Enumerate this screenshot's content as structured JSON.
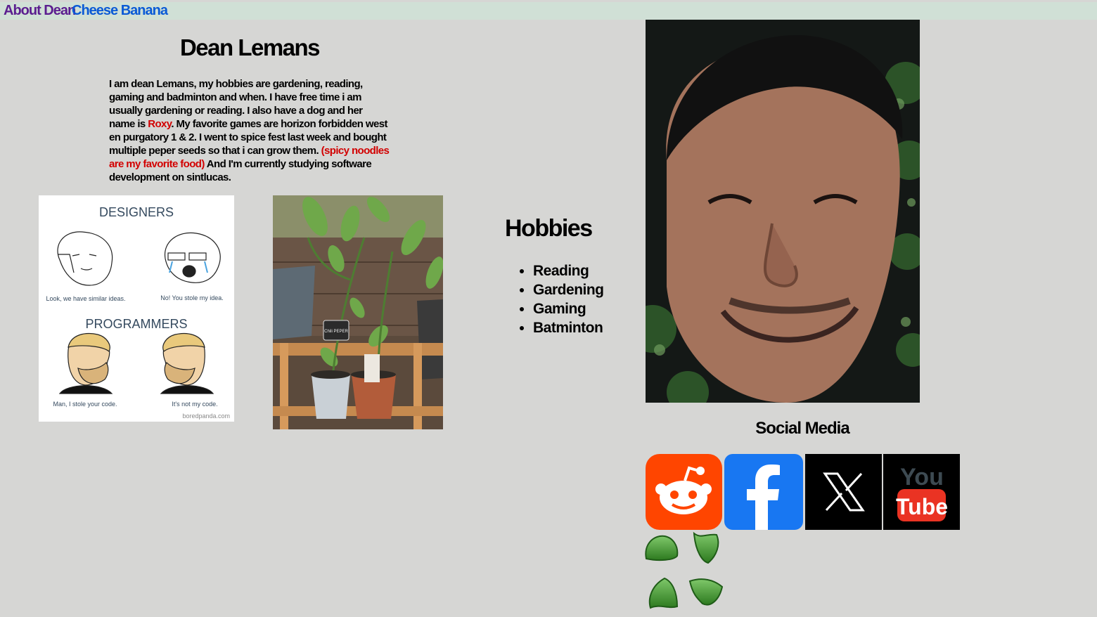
{
  "nav": {
    "about_label": "About Dean",
    "cheese_label": "Cheese Banana"
  },
  "profile": {
    "name": "Dean Lemans",
    "bio": {
      "part1": "I am dean Lemans, my hobbies are gardening, reading, gaming and badminton and when. I have free time i am usually gardening or reading. I also have a dog and her name is ",
      "dog_name": "Roxy",
      "part2": ". My favorite games are horizon forbidden west en purgatory 1 & 2. I went to spice fest last week and bought multiple peper seeds so that i can grow them. ",
      "food_highlight": "(spicy noodles are my favorite food)",
      "part3": " And I'm currently studying software development on sintlucas."
    }
  },
  "meme": {
    "designers_heading": "DESIGNERS",
    "designers_left_caption": "Look, we have similar ideas.",
    "designers_right_caption": "No! You stole my idea.",
    "programmers_heading": "PROGRAMMERS",
    "programmers_left_caption": "Man, I stole your code.",
    "programmers_right_caption": "It's not my code.",
    "watermark": "boredpanda.com"
  },
  "plant_photo": {
    "label_text": "Chili PEPER"
  },
  "hobbies": {
    "title": "Hobbies",
    "items": [
      "Reading",
      "Gardening",
      "Gaming",
      "Batminton"
    ]
  },
  "social": {
    "title": "Social Media",
    "icons": [
      "reddit-icon",
      "facebook-icon",
      "x-icon",
      "youtube-icon"
    ],
    "youtube_you": "You",
    "youtube_tube": "Tube"
  },
  "colors": {
    "page_bg": "#d6d6d4",
    "nav_bg": "#d0e0d6",
    "nav_about": "#5b1e8f",
    "nav_cheese": "#0a5ad6",
    "highlight_red": "#d20000",
    "reddit_orange": "#ff4500",
    "facebook_blue": "#1877f2",
    "youtube_red": "#ea3323",
    "clover_green": "#3f8f2a"
  }
}
